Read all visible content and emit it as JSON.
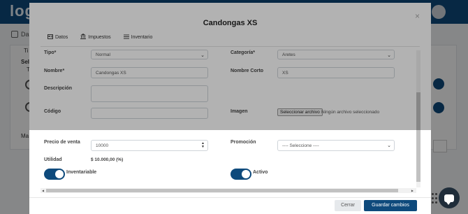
{
  "app": {
    "logo_text": "log",
    "crumb_text": "Dash",
    "side_texts": [
      "Ti",
      "Sele",
      "T",
      "Ma"
    ]
  },
  "modal": {
    "title": "Candongas XS",
    "close_symbol": "×",
    "tabs": [
      {
        "label": "Datos",
        "icon": "datos-icon"
      },
      {
        "label": "Impuestos",
        "icon": "bank-icon"
      },
      {
        "label": "Inventario",
        "icon": "list-icon"
      }
    ]
  },
  "form": {
    "tipo_label": "Tipo*",
    "tipo_value": "Normal",
    "categoria_label": "Categoría*",
    "categoria_value": "Aretes",
    "nombre_label": "Nombre*",
    "nombre_value": "Candongas XS",
    "nombre_corto_label": "Nombre Corto",
    "nombre_corto_value": "XS",
    "descripcion_label": "Descripción",
    "descripcion_value": "",
    "codigo_label": "Código",
    "codigo_value": "",
    "imagen_label": "Imagen",
    "file_button": "Seleccionar archivo",
    "file_status": "Ningún archivo seleccionado",
    "precio_label": "Precio de venta",
    "precio_value": "10000",
    "promocion_label": "Promoción",
    "promocion_value": "---- Seleccione ----",
    "utilidad_label": "Utilidad",
    "utilidad_value": "$ 10.000,00 (%)",
    "inventariable_label": "Inventariable",
    "inventariable_on": true,
    "activo_label": "Activo",
    "activo_on": true
  },
  "footer": {
    "close_label": "Cerrar",
    "save_label": "Guardar cambios"
  },
  "colors": {
    "primary": "#0e4a7c",
    "header": "#0e4a7c"
  }
}
